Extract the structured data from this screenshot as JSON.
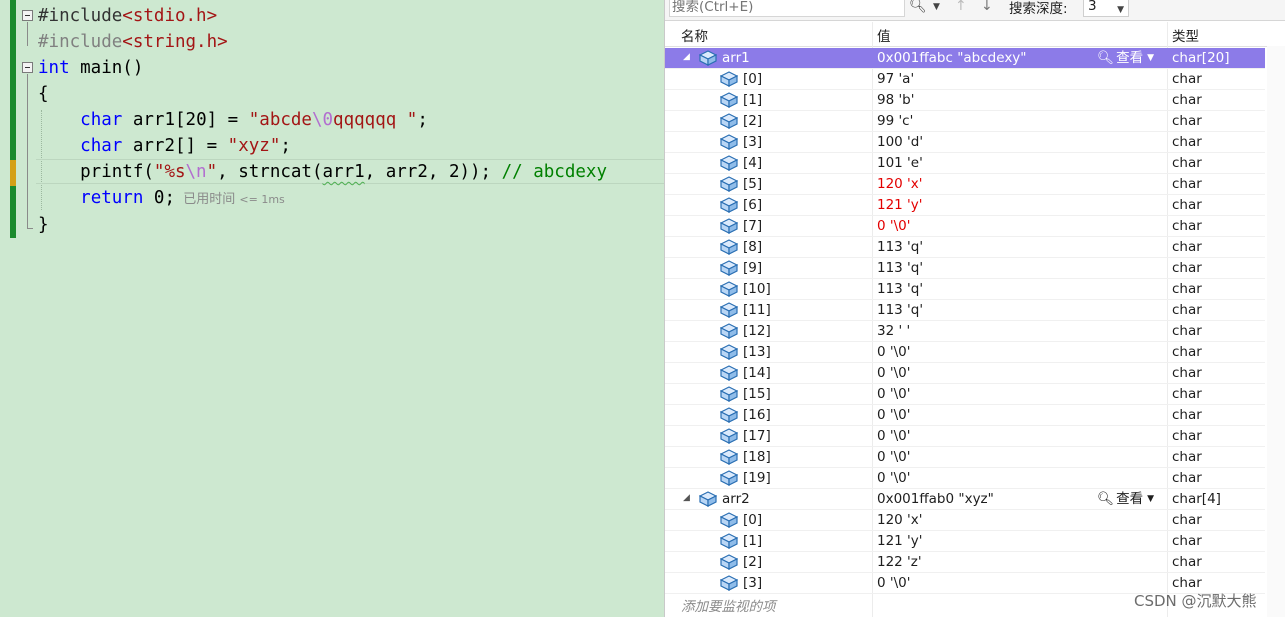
{
  "editor": {
    "lines": [
      {
        "id": "include1",
        "parts": [
          {
            "t": "#include",
            "c": "pre-blk"
          },
          {
            "t": "<stdio.h>",
            "c": "incl"
          }
        ]
      },
      {
        "id": "include2",
        "parts": [
          {
            "t": "#include",
            "c": "pre"
          },
          {
            "t": "<string.h>",
            "c": "incl"
          }
        ]
      },
      {
        "id": "main",
        "parts": [
          {
            "t": "int",
            "c": "kw"
          },
          {
            "t": " main()",
            "c": ""
          }
        ]
      },
      {
        "id": "brace-open",
        "parts": [
          {
            "t": "{",
            "c": ""
          }
        ]
      },
      {
        "id": "arr1",
        "parts": [
          {
            "t": "    ",
            "c": ""
          },
          {
            "t": "char",
            "c": "kw"
          },
          {
            "t": " arr1[20] = ",
            "c": ""
          },
          {
            "t": "\"abcde",
            "c": "str"
          },
          {
            "t": "\\0",
            "c": "esc"
          },
          {
            "t": "qqqqqq \"",
            "c": "str"
          },
          {
            "t": ";",
            "c": ""
          }
        ]
      },
      {
        "id": "arr2",
        "parts": [
          {
            "t": "    ",
            "c": ""
          },
          {
            "t": "char",
            "c": "kw"
          },
          {
            "t": " arr2[] = ",
            "c": ""
          },
          {
            "t": "\"xyz\"",
            "c": "str"
          },
          {
            "t": ";",
            "c": ""
          }
        ]
      },
      {
        "id": "printf",
        "parts": [
          {
            "t": "    printf(",
            "c": ""
          },
          {
            "t": "\"%s",
            "c": "str"
          },
          {
            "t": "\\n",
            "c": "esc"
          },
          {
            "t": "\"",
            "c": "str"
          },
          {
            "t": ", strncat(",
            "c": ""
          },
          {
            "t": "arr1",
            "c": "squig"
          },
          {
            "t": ", arr2, 2)); ",
            "c": ""
          },
          {
            "t": "// abcdexy",
            "c": "cmt"
          }
        ]
      },
      {
        "id": "return",
        "parts": [
          {
            "t": "    ",
            "c": ""
          },
          {
            "t": "return",
            "c": "kw"
          },
          {
            "t": " 0;",
            "c": ""
          }
        ]
      },
      {
        "id": "brace-close",
        "parts": [
          {
            "t": "}",
            "c": ""
          }
        ]
      }
    ],
    "elapsed_hint": "已用时间",
    "elapsed_value": "<= 1ms"
  },
  "watch": {
    "search_placeholder": "搜索(Ctrl+E)",
    "search_depth_label": "搜索深度:",
    "search_depth_value": "3",
    "columns": {
      "name": "名称",
      "value": "值",
      "type": "类型"
    },
    "view_label": "查看",
    "add_watch_label": "添加要监视的项",
    "rows": [
      {
        "level": 0,
        "name": "arr1",
        "value": "0x001ffabc \"abcdexy\"",
        "type": "char[20]",
        "selected": true,
        "view": true
      },
      {
        "level": 1,
        "name": "[0]",
        "value": "97 'a'",
        "type": "char"
      },
      {
        "level": 1,
        "name": "[1]",
        "value": "98 'b'",
        "type": "char"
      },
      {
        "level": 1,
        "name": "[2]",
        "value": "99 'c'",
        "type": "char"
      },
      {
        "level": 1,
        "name": "[3]",
        "value": "100 'd'",
        "type": "char"
      },
      {
        "level": 1,
        "name": "[4]",
        "value": "101 'e'",
        "type": "char"
      },
      {
        "level": 1,
        "name": "[5]",
        "value": "120 'x'",
        "type": "char",
        "changed": true
      },
      {
        "level": 1,
        "name": "[6]",
        "value": "121 'y'",
        "type": "char",
        "changed": true
      },
      {
        "level": 1,
        "name": "[7]",
        "value": "0 '\\0'",
        "type": "char",
        "changed": true
      },
      {
        "level": 1,
        "name": "[8]",
        "value": "113 'q'",
        "type": "char"
      },
      {
        "level": 1,
        "name": "[9]",
        "value": "113 'q'",
        "type": "char"
      },
      {
        "level": 1,
        "name": "[10]",
        "value": "113 'q'",
        "type": "char"
      },
      {
        "level": 1,
        "name": "[11]",
        "value": "113 'q'",
        "type": "char"
      },
      {
        "level": 1,
        "name": "[12]",
        "value": "32 ' '",
        "type": "char"
      },
      {
        "level": 1,
        "name": "[13]",
        "value": "0 '\\0'",
        "type": "char"
      },
      {
        "level": 1,
        "name": "[14]",
        "value": "0 '\\0'",
        "type": "char"
      },
      {
        "level": 1,
        "name": "[15]",
        "value": "0 '\\0'",
        "type": "char"
      },
      {
        "level": 1,
        "name": "[16]",
        "value": "0 '\\0'",
        "type": "char"
      },
      {
        "level": 1,
        "name": "[17]",
        "value": "0 '\\0'",
        "type": "char"
      },
      {
        "level": 1,
        "name": "[18]",
        "value": "0 '\\0'",
        "type": "char"
      },
      {
        "level": 1,
        "name": "[19]",
        "value": "0 '\\0'",
        "type": "char"
      },
      {
        "level": 0,
        "name": "arr2",
        "value": "0x001ffab0 \"xyz\"",
        "type": "char[4]",
        "view": true
      },
      {
        "level": 1,
        "name": "[0]",
        "value": "120 'x'",
        "type": "char"
      },
      {
        "level": 1,
        "name": "[1]",
        "value": "121 'y'",
        "type": "char"
      },
      {
        "level": 1,
        "name": "[2]",
        "value": "122 'z'",
        "type": "char"
      },
      {
        "level": 1,
        "name": "[3]",
        "value": "0 '\\0'",
        "type": "char"
      }
    ]
  },
  "watermark": "CSDN @沉默大熊",
  "colors": {
    "selection": "#8c7be8",
    "changed_value": "#e30000",
    "editor_bg": "#cde8d0",
    "change_bar_saved": "#1b8a2e",
    "change_bar_unsaved": "#d4a017"
  }
}
